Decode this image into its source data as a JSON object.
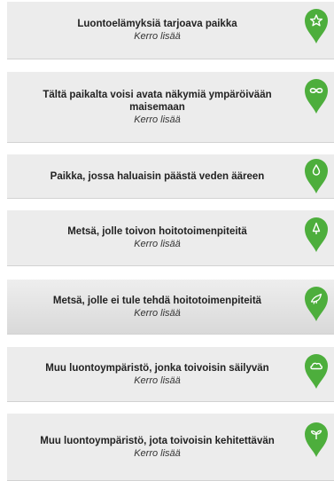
{
  "accent_color": "#4dae3c",
  "options": [
    {
      "title": "Luontoelämyksiä tarjoava paikka",
      "more": "Kerro lisää",
      "icon": "star-icon"
    },
    {
      "title": "Tältä paikalta voisi avata näkymiä ympäröivään maisemaan",
      "more": "Kerro lisää",
      "icon": "infinity-icon"
    },
    {
      "title": "Paikka, jossa haluaisin päästä veden ääreen",
      "more": "",
      "icon": "water-drop-icon"
    },
    {
      "title": "Metsä, jolle toivon hoitotoimenpiteitä",
      "more": "Kerro lisää",
      "icon": "tree-icon"
    },
    {
      "title": "Metsä, jolle ei tule tehdä hoitotoimenpiteitä",
      "more": "Kerro lisää",
      "icon": "bird-icon"
    },
    {
      "title": "Muu luontoympäristö, jonka toivoisin säilyvän",
      "more": "Kerro lisää",
      "icon": "cloud-icon"
    },
    {
      "title": "Muu luontoympäristö, jota toivoisin kehitettävän",
      "more": "Kerro lisää",
      "icon": "sprout-icon"
    }
  ]
}
